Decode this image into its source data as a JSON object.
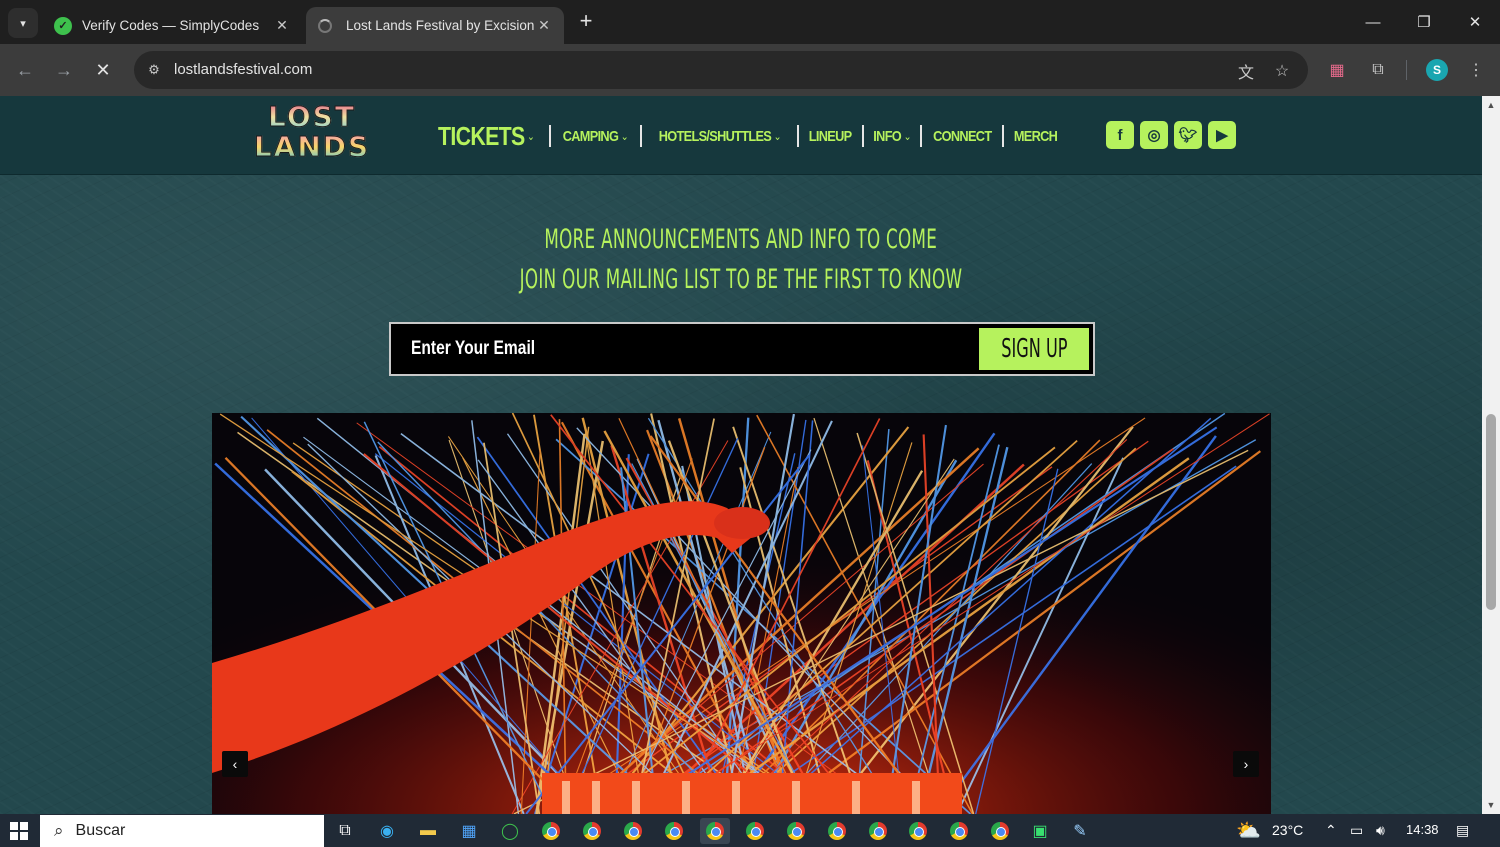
{
  "browser": {
    "tabs": [
      {
        "title": "Verify Codes — SimplyCodes",
        "active": false
      },
      {
        "title": "Lost Lands Festival by Excision |",
        "active": true
      }
    ],
    "new_tab": "+",
    "url": "lostlandsfestival.com"
  },
  "site": {
    "logo_line1": "LOST",
    "logo_line2": "LANDS",
    "nav": [
      {
        "label": "TICKETS",
        "dropdown": true
      },
      {
        "label": "CAMPING",
        "dropdown": true
      },
      {
        "label": "HOTELS/SHUTTLES",
        "dropdown": true
      },
      {
        "label": "LINEUP",
        "dropdown": false
      },
      {
        "label": "INFO",
        "dropdown": true
      },
      {
        "label": "CONNECT",
        "dropdown": false
      },
      {
        "label": "MERCH",
        "dropdown": false
      }
    ],
    "social": [
      "facebook",
      "instagram",
      "twitter",
      "youtube"
    ],
    "announce_line1": "MORE ANNOUNCEMENTS AND INFO TO COME",
    "announce_line2": "JOIN OUR MAILING LIST TO BE THE FIRST TO KNOW",
    "email_placeholder": "Enter Your Email",
    "signup_label": "SIGN UP",
    "accent_color": "#b6f25d"
  },
  "taskbar": {
    "search_label": "Buscar",
    "weather": "23°C",
    "time": "14:38"
  }
}
